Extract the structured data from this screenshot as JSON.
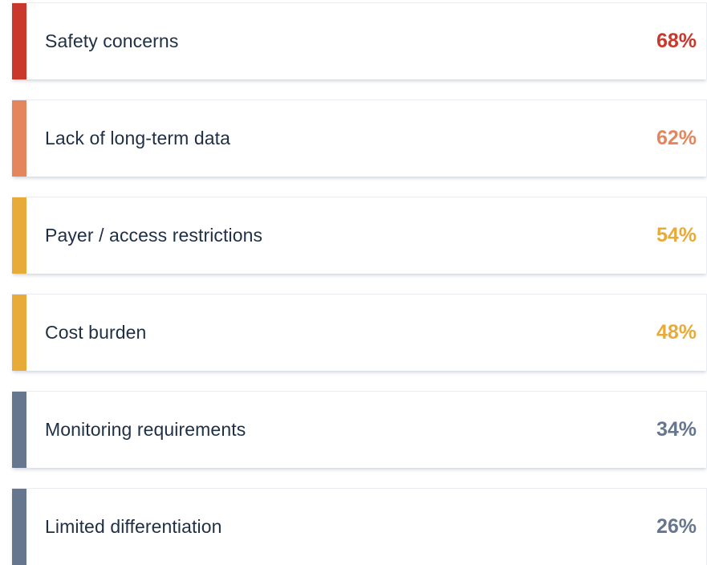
{
  "chart_data": {
    "type": "bar",
    "categories": [
      "Safety concerns",
      "Lack of long-term data",
      "Payer / access restrictions",
      "Cost burden",
      "Monitoring requirements",
      "Limited differentiation"
    ],
    "values": [
      68,
      62,
      54,
      48,
      34,
      26
    ],
    "value_labels": [
      "68%",
      "62%",
      "54%",
      "48%",
      "34%",
      "26%"
    ],
    "colors": [
      "#c9382b",
      "#e5855d",
      "#e8ab3a",
      "#e8ab3a",
      "#66768e",
      "#66768e"
    ]
  }
}
